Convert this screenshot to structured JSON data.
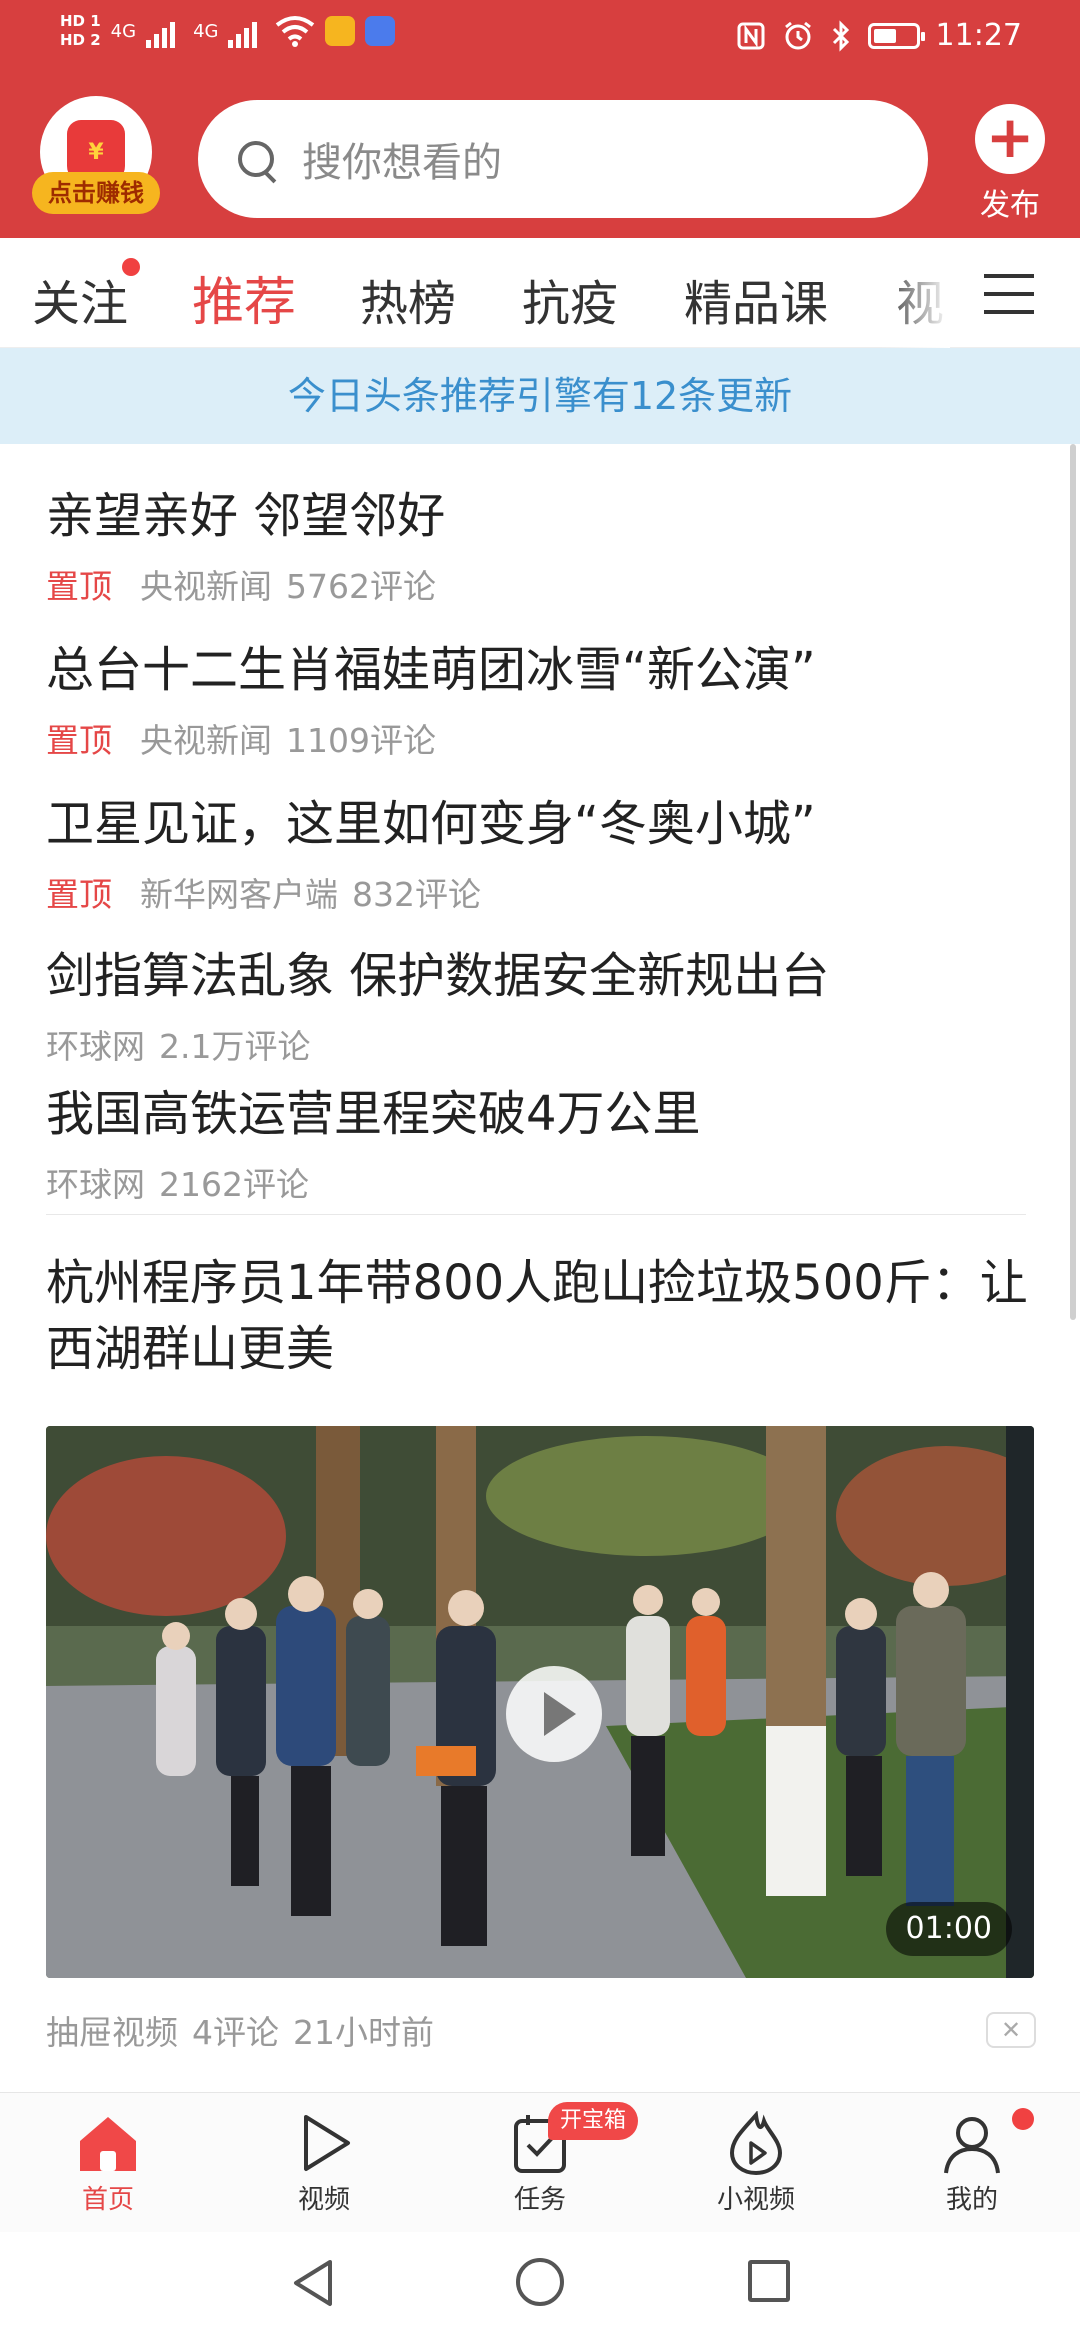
{
  "status_bar": {
    "hd1": "HD 1",
    "hd2": "HD 2",
    "net1": "4G",
    "net2": "4G",
    "time": "11:27",
    "app_icon_colors": [
      "#f6b51f",
      "#4b7bec"
    ]
  },
  "header": {
    "earn_label": "点击赚钱",
    "search_placeholder": "搜你想看的",
    "publish_label": "发布",
    "bg_color": "#d73f3f"
  },
  "tabs": [
    {
      "label": "关注",
      "has_dot": true
    },
    {
      "label": "推荐",
      "active": true
    },
    {
      "label": "热榜"
    },
    {
      "label": "抗疫"
    },
    {
      "label": "精品课"
    },
    {
      "label": "视"
    }
  ],
  "banner": "今日头条推荐引擎有12条更新",
  "news": [
    {
      "title": "亲望亲好 邻望邻好",
      "pin": "置顶",
      "source": "央视新闻",
      "comments": "5762评论"
    },
    {
      "title": "总台十二生肖福娃萌团冰雪“新公演”",
      "pin": "置顶",
      "source": "央视新闻",
      "comments": "1109评论"
    },
    {
      "title": "卫星见证，这里如何变身“冬奥小城”",
      "pin": "置顶",
      "source": "新华网客户端",
      "comments": "832评论"
    },
    {
      "title": "剑指算法乱象 保护数据安全新规出台",
      "source": "环球网",
      "comments": "2.1万评论"
    },
    {
      "title": "我国高铁运营里程突破4万公里",
      "source": "环球网",
      "comments": "2162评论"
    }
  ],
  "video_post": {
    "title": "杭州程序员1年带800人跑山捡垃圾500斤：让西湖群山更美",
    "duration": "01:00",
    "source": "抽屉视频",
    "comments": "4评论",
    "time": "21小时前"
  },
  "bottom_nav": [
    {
      "label": "首页",
      "icon": "home-icon",
      "active": true
    },
    {
      "label": "视频",
      "icon": "play-icon"
    },
    {
      "label": "任务",
      "icon": "task-icon",
      "badge": "开宝箱"
    },
    {
      "label": "小视频",
      "icon": "flame-play-icon"
    },
    {
      "label": "我的",
      "icon": "user-icon",
      "has_dot": true
    }
  ]
}
